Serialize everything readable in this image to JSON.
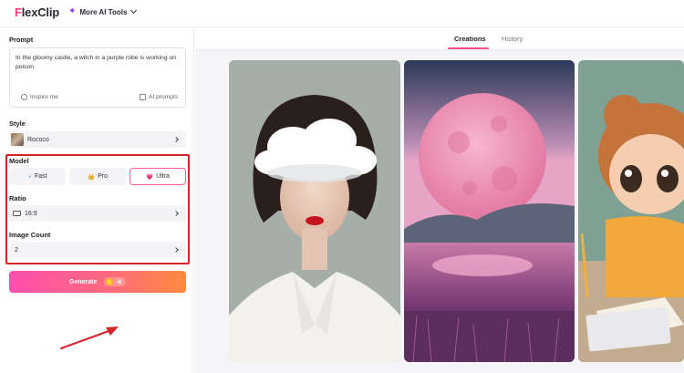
{
  "header": {
    "logo_mark": "F",
    "logo_rest": "lexClip",
    "ai_tools_label": "More AI Tools"
  },
  "left": {
    "prompt_label": "Prompt",
    "prompt_text": "In the gloomy castle, a witch in a purple robe is working on poison",
    "inspire_label": "Inspire me",
    "ai_prompts_label": "AI prompts",
    "style_label": "Style",
    "style_value": "Rococo",
    "model_label": "Model",
    "models": [
      {
        "label": "Fast",
        "icon": "⚡"
      },
      {
        "label": "Pro",
        "icon": "👑"
      },
      {
        "label": "Ultra",
        "icon": "💗"
      }
    ],
    "selected_model": "Ultra",
    "ratio_label": "Ratio",
    "ratio_value": "16:9",
    "image_count_label": "Image Count",
    "image_count_value": "2",
    "generate_label": "Generate",
    "credit_value": "-6"
  },
  "right": {
    "tabs": [
      {
        "label": "Creations",
        "active": true
      },
      {
        "label": "History",
        "active": false
      }
    ]
  },
  "colors": {
    "brand": "#ff3f76",
    "accent_pink": "#ff4fae",
    "accent_orange": "#ff8a3d",
    "highlight_red": "#d8232a"
  }
}
